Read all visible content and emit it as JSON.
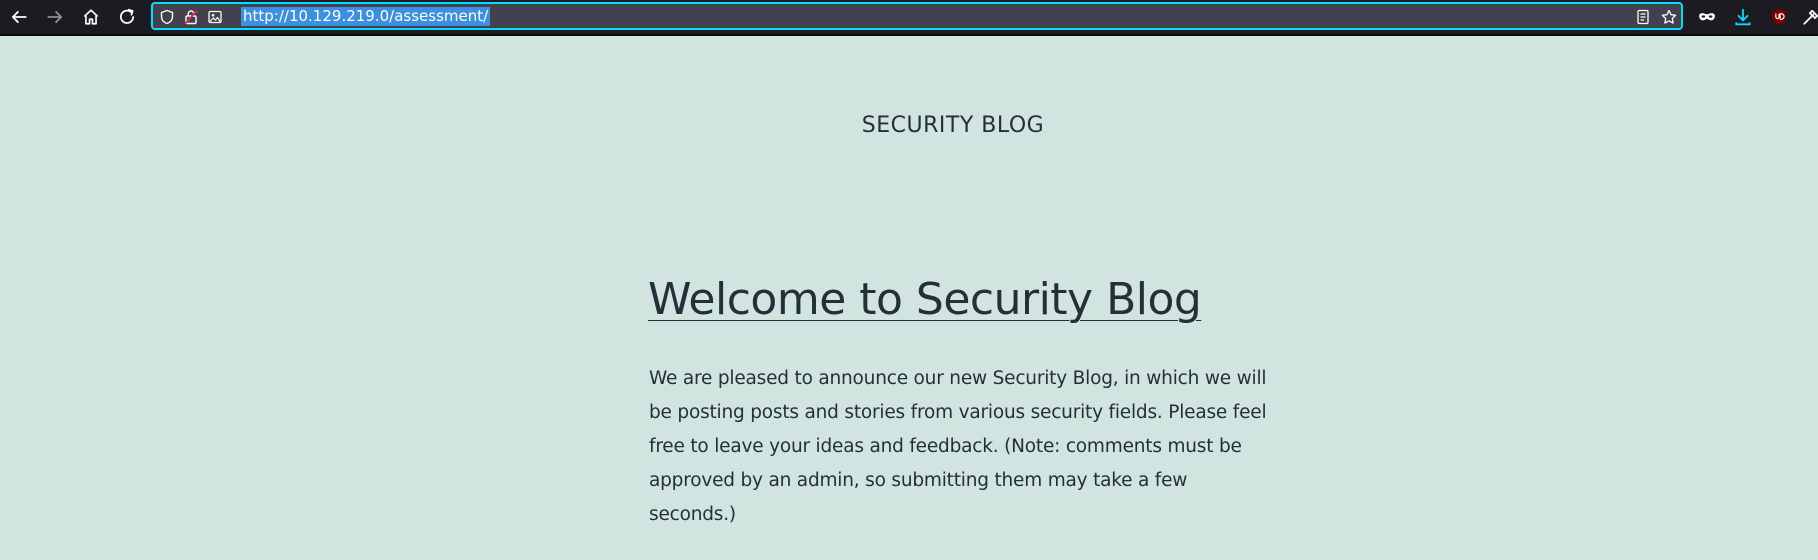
{
  "browser": {
    "url": "http://10.129.219.0/assessment/",
    "toolbar_icons": [
      "back-arrow-icon",
      "forward-arrow-icon",
      "home-icon",
      "reload-icon",
      "tracking-shield-icon",
      "insecure-lock-icon",
      "permissions-image-icon",
      "reader-view-icon",
      "bookmark-star-icon",
      "private-mask-icon",
      "download-icon",
      "ublock-icon",
      "extension-icon"
    ],
    "colors": {
      "toolbar": "#1c1b22",
      "urlbar": "#42414d",
      "focus_ring": "#00ddff",
      "selection": "#3d8fe0"
    }
  },
  "page": {
    "site_title": "SECURITY BLOG",
    "post_title": "Welcome to Security Blog",
    "post_body": "We are pleased to announce our new Security Blog, in which we will be posting posts and stories from various security fields. Please feel free to leave your ideas and feedback. (Note: comments must be approved by an admin, so submitting them may take a few seconds.)",
    "colors": {
      "background": "#d1e4df",
      "text": "#23303a"
    }
  }
}
